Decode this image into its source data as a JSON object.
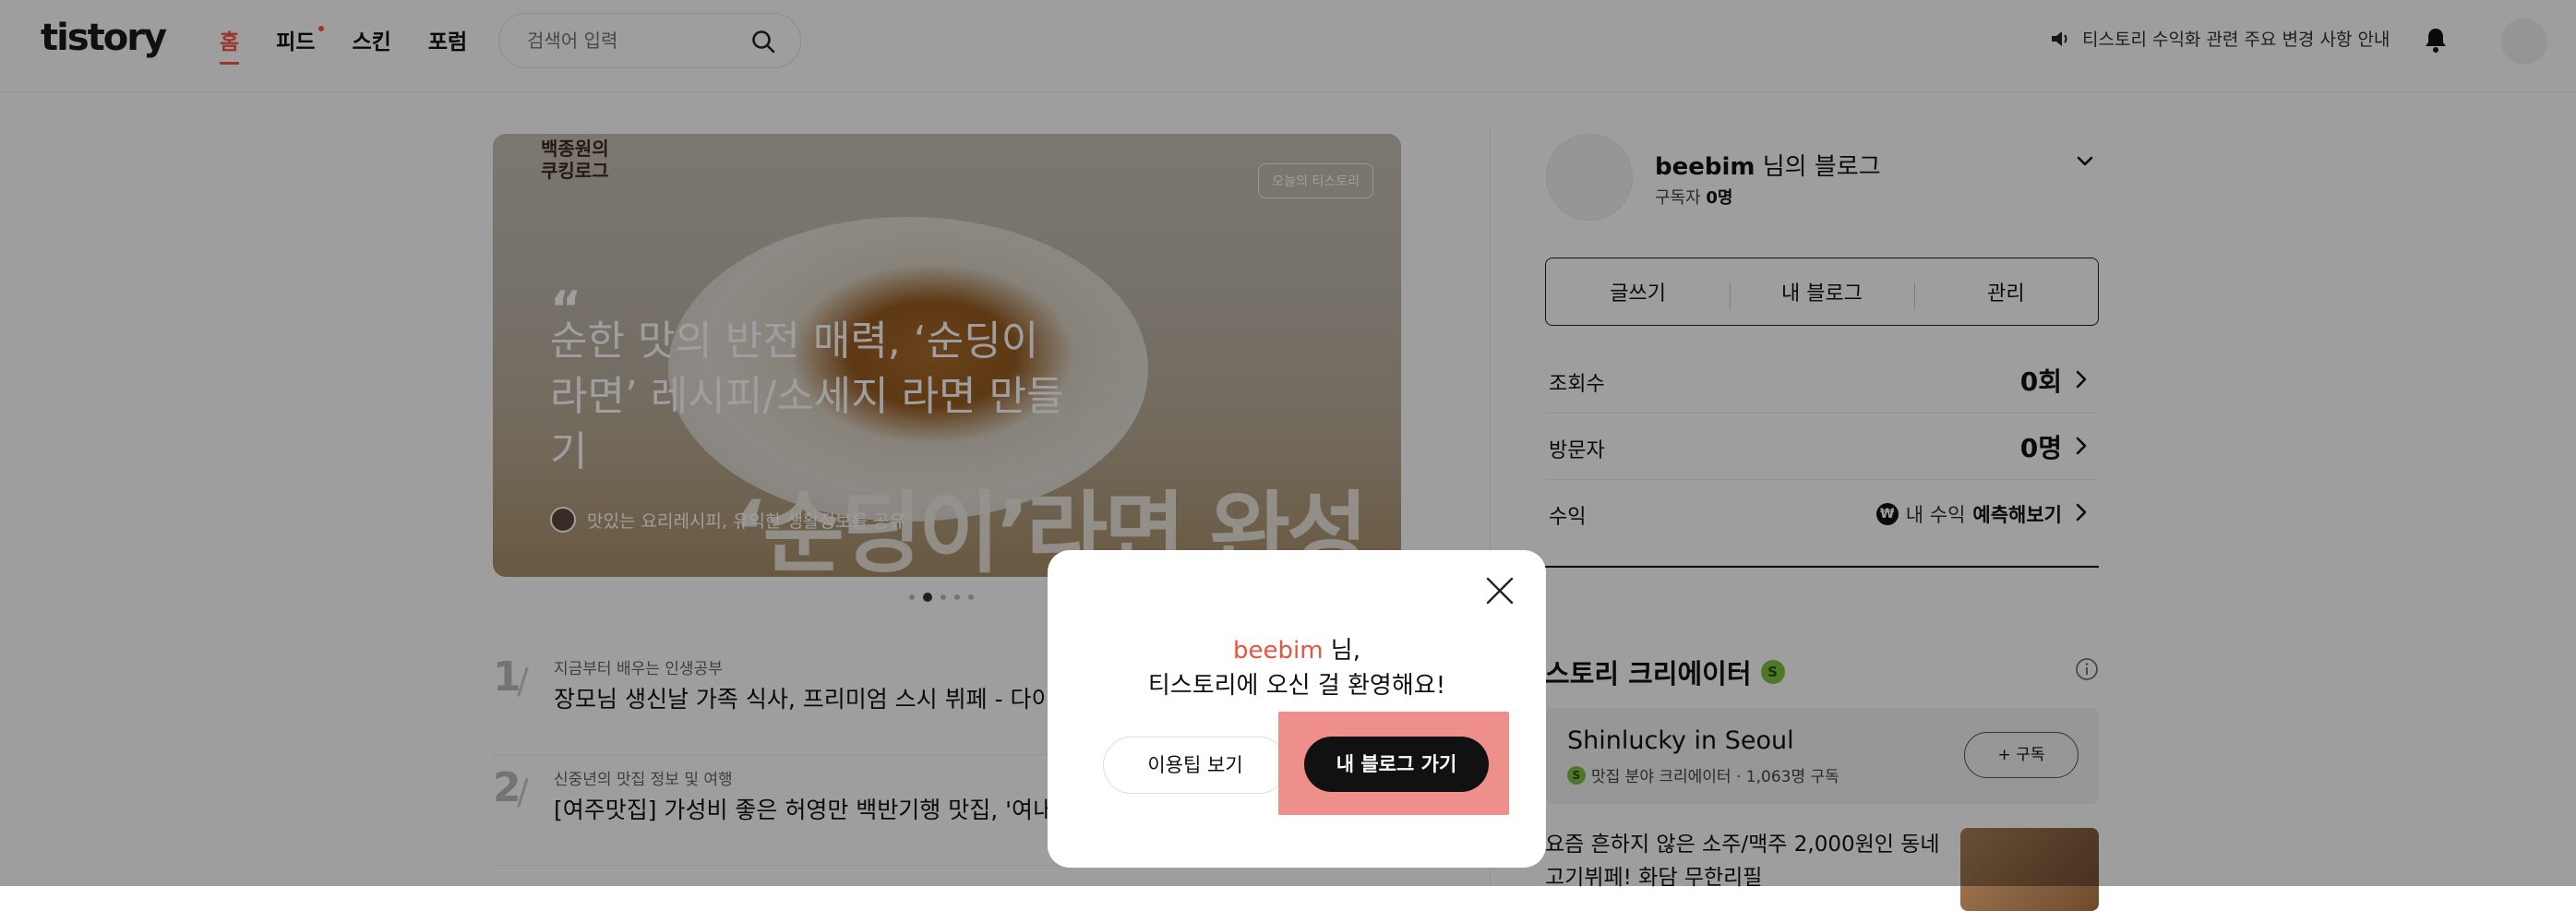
{
  "header": {
    "logo": "tistory",
    "nav": [
      "홈",
      "피드",
      "스킨",
      "포럼"
    ],
    "search_placeholder": "검색어 입력",
    "notice": "티스토리 수익화 관련 주요 변경 사항 안내"
  },
  "hero": {
    "brand_line1": "백종원의",
    "brand_line2": "쿠킹로그",
    "badge": "오늘의 티스토리",
    "quote_mark": "“",
    "title": "순한 맛의 반전 매력, ‘순딩이 라면’ 레시피/소세지 라면 만들기",
    "author": "맛있는 요리레시피, 유익한 생활정보를 공유",
    "overlay_text": "‘순딩이’라면 완성"
  },
  "feed": [
    {
      "num": "1",
      "category": "지금부터 배우는 인생공부",
      "title": "장모님 생신날 가족 식사, 프리미엄 스시 뷔페 - 다이"
    },
    {
      "num": "2",
      "category": "신중년의 맛집 정보 및 여행",
      "title": "[여주맛집] 가성비 좋은 허영만 백반기행 맛집, '여내"
    }
  ],
  "profile": {
    "name": "beebim",
    "name_suffix": " 님의 블로그",
    "subs_label": "구독자 ",
    "subs_value": "0명",
    "actions": [
      "글쓰기",
      "내 블로그",
      "관리"
    ],
    "stats": [
      {
        "label": "조회수",
        "value": "0회"
      },
      {
        "label": "방문자",
        "value": "0명"
      }
    ],
    "earn_label": "수익",
    "earn_prefix": "내 수익 ",
    "earn_action": "예측해보기",
    "won_symbol": "₩"
  },
  "creator": {
    "section_title": "스토리 크리에이터",
    "badge": "S",
    "name": "Shinlucky in Seoul",
    "meta": "맛집 분야 크리에이터 · 1,063명 구독",
    "subscribe": "+ 구독",
    "post_title": "요즘 흔하지 않은 소주/맥주 2,000원인 동네 고기뷔페! 화담 무한리필"
  },
  "modal": {
    "user": "beebim",
    "greeting_suffix": " 님,",
    "line2": "티스토리에 오신 걸 환영해요!",
    "tips_button": "이용팁 보기",
    "myblog_button": "내 블로그 가기"
  },
  "colors": {
    "accent": "#ff5544",
    "user_name": "#e8553e",
    "highlight": "#ef8f8b"
  }
}
